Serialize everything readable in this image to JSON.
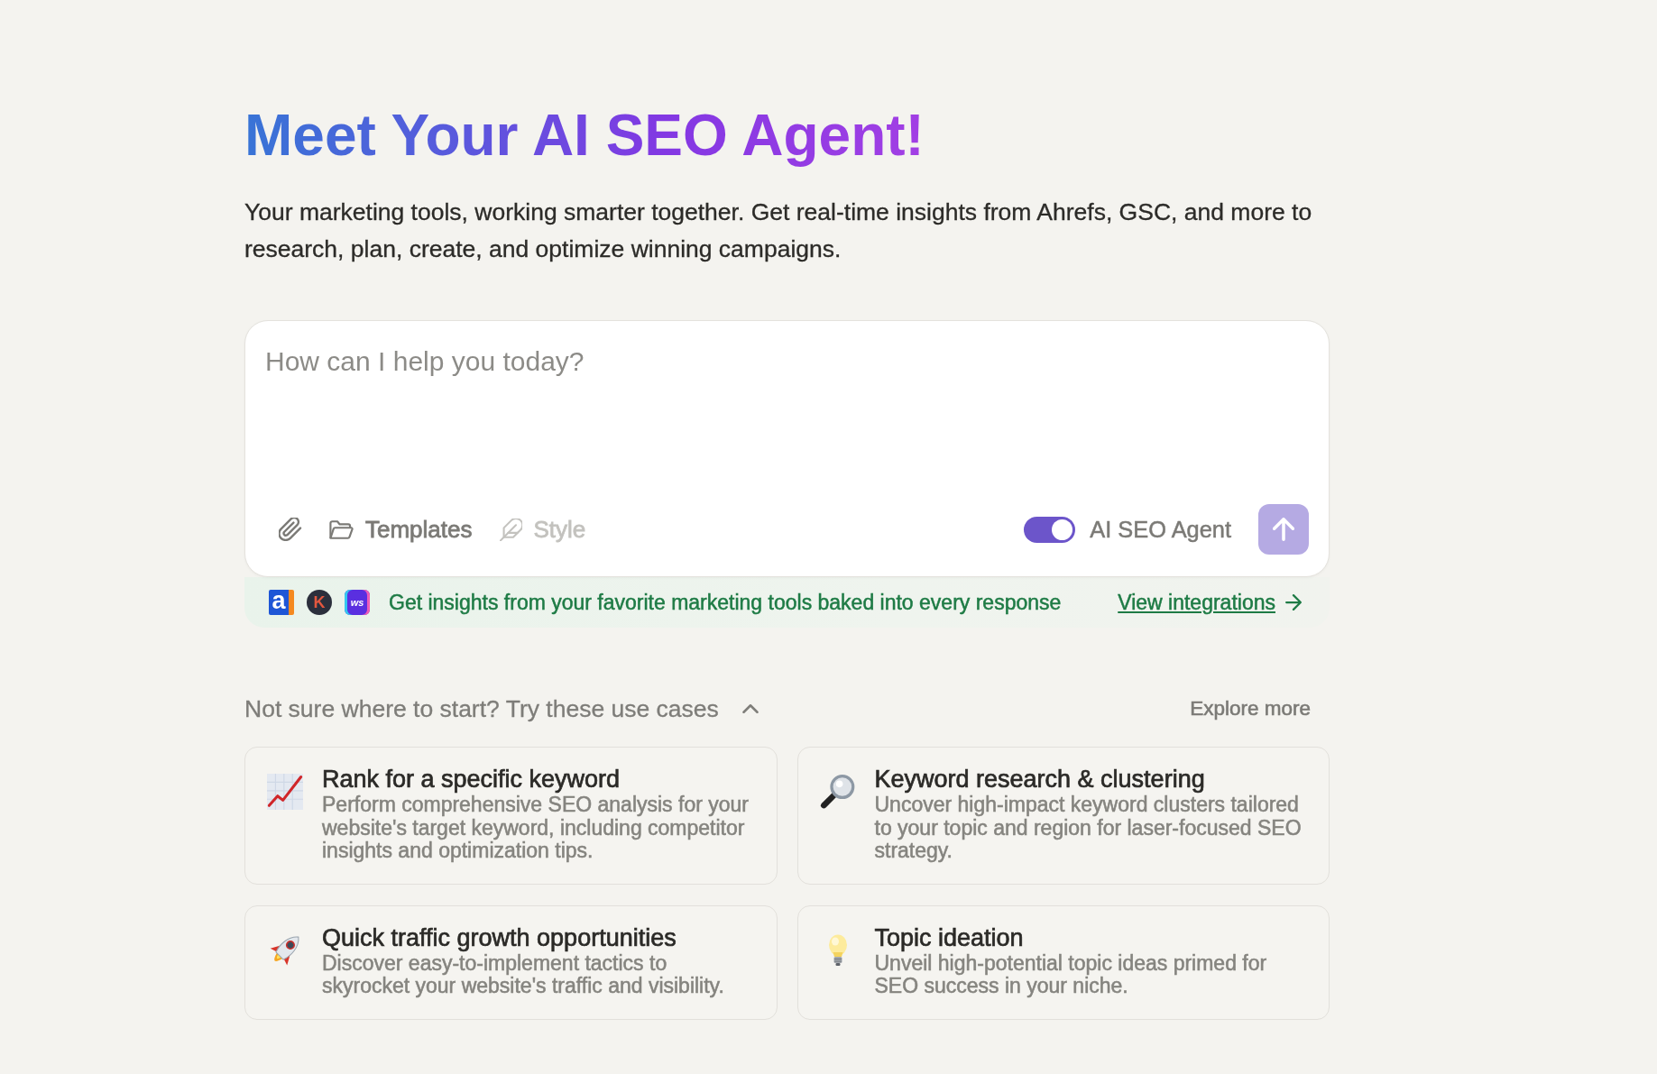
{
  "heading": "Meet Your AI SEO Agent!",
  "intro": "Your marketing tools, working smarter together. Get real-time insights from Ahrefs, GSC, and more to research, plan, create, and optimize winning campaigns.",
  "composer": {
    "placeholder": "How can I help you today?",
    "tools": [
      {
        "label": "Templates",
        "disabled": false
      },
      {
        "label": "Style",
        "disabled": true
      }
    ],
    "agent_toggle": {
      "label": "AI SEO Agent",
      "on": true
    },
    "send_button": {
      "disabled": true
    }
  },
  "integrations": {
    "logos": [
      {
        "kind": "square",
        "text": "a",
        "color": "#1e56d6"
      },
      {
        "kind": "circle",
        "text": "K",
        "color": "#2b2f3c"
      },
      {
        "kind": "tile",
        "text": "ws",
        "color": "#5a2fe0"
      }
    ],
    "text": "Get insights from your favorite marketing tools baked into every response",
    "link": "View integrations"
  },
  "use_cases": {
    "title": "Not sure where to start? Try these use cases",
    "expanded": true,
    "explore_link": "Explore more",
    "cards": [
      {
        "title": "Rank for a specific keyword",
        "description": "Perform comprehensive SEO analysis for your website's target keyword, including competitor insights and optimization tips."
      },
      {
        "title": "Keyword research & clustering",
        "description": "Uncover high-impact keyword clusters tailored to your topic and region for laser-focused SEO strategy."
      },
      {
        "title": "Quick traffic growth opportunities",
        "description": "Discover easy-to-implement tactics to skyrocket your website's traffic and visibility."
      },
      {
        "title": "Topic ideation",
        "description": "Unveil high-potential topic ideas primed for SEO success in your niche."
      }
    ]
  }
}
